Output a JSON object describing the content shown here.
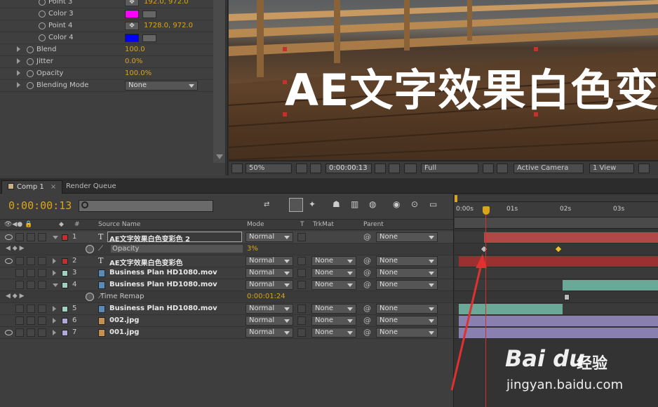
{
  "effects": {
    "rows": [
      {
        "label": "Point 3",
        "value": "192.0, 972.0",
        "type": "point"
      },
      {
        "label": "Color 3",
        "color": "#ff00ff",
        "type": "color"
      },
      {
        "label": "Point 4",
        "value": "1728.0, 972.0",
        "type": "point"
      },
      {
        "label": "Color 4",
        "color": "#0000ff",
        "type": "color"
      },
      {
        "label": "Blend",
        "value": "100.0",
        "type": "param"
      },
      {
        "label": "Jitter",
        "value": "0.0%",
        "type": "param"
      },
      {
        "label": "Opacity",
        "value": "100.0%",
        "type": "param"
      },
      {
        "label": "Blending Mode",
        "value": "None",
        "type": "dropdown"
      }
    ]
  },
  "viewer": {
    "text": "AE文字效果白色变",
    "zoom": "50%",
    "timecode": "0:00:00:13",
    "resolution": "Full",
    "camera": "Active Camera",
    "view": "1 View"
  },
  "timeline": {
    "tabs": [
      "Comp 1",
      "Render Queue"
    ],
    "timecode": "0:00:00:13",
    "headers": {
      "number": "#",
      "source": "Source Name",
      "mode": "Mode",
      "t": "T",
      "trkmat": "TrkMat",
      "parent": "Parent"
    },
    "ruler": [
      "0:00s",
      "01s",
      "02s",
      "03s"
    ],
    "layers": [
      {
        "num": "1",
        "name": "AE文字效果白色变彩色 2",
        "kind": "text",
        "color": "#c03030",
        "mode": "Normal",
        "trkmat": "",
        "parent": "None",
        "open": true,
        "selected": true
      },
      {
        "num": "",
        "name": "Opacity",
        "kind": "prop",
        "value": "3%"
      },
      {
        "num": "2",
        "name": "AE文字效果白色变彩色",
        "kind": "text",
        "color": "#c03030",
        "mode": "Normal",
        "trkmat": "None",
        "parent": "None"
      },
      {
        "num": "3",
        "name": "Business Plan HD1080.mov",
        "kind": "file",
        "color": "#9fd0c0",
        "mode": "Normal",
        "trkmat": "None",
        "parent": "None"
      },
      {
        "num": "4",
        "name": "Business Plan HD1080.mov",
        "kind": "file",
        "color": "#9fd0c0",
        "mode": "Normal",
        "trkmat": "None",
        "parent": "None",
        "open": true
      },
      {
        "num": "",
        "name": "Time Remap",
        "kind": "prop",
        "value": "0:00:01:24"
      },
      {
        "num": "5",
        "name": "Business Plan HD1080.mov",
        "kind": "file",
        "color": "#9fd0c0",
        "mode": "Normal",
        "trkmat": "None",
        "parent": "None"
      },
      {
        "num": "6",
        "name": "002.jpg",
        "kind": "image",
        "color": "#b0a8d8",
        "mode": "Normal",
        "trkmat": "None",
        "parent": "None"
      },
      {
        "num": "7",
        "name": "001.jpg",
        "kind": "image",
        "color": "#b0a8d8",
        "mode": "Normal",
        "trkmat": "None",
        "parent": "None"
      }
    ]
  },
  "watermark": {
    "logo": "Bai du",
    "cn": "经验",
    "url": "jingyan.baidu.com"
  }
}
